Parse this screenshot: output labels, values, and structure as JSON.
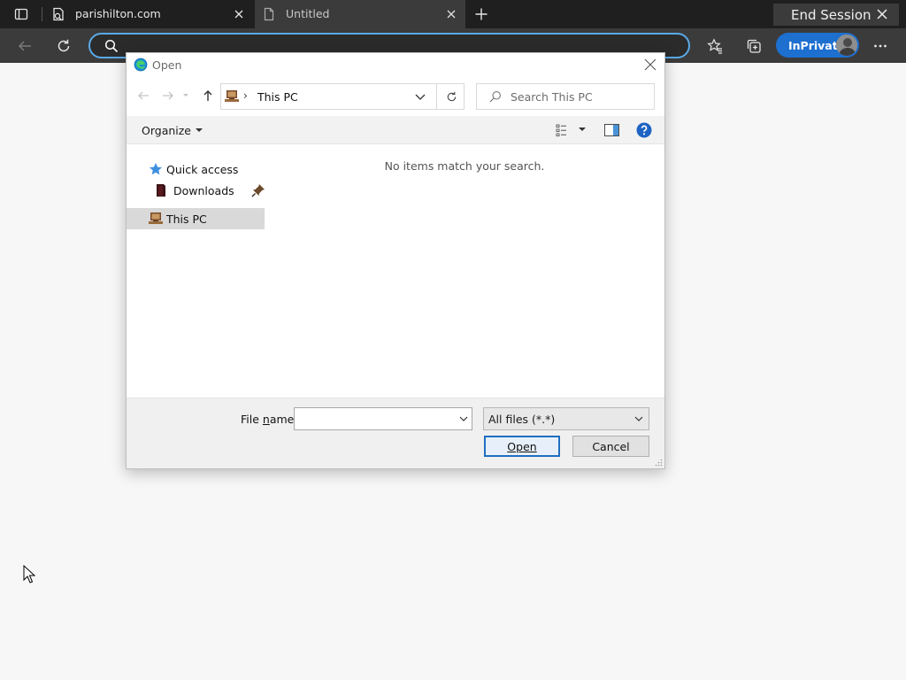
{
  "browser": {
    "tabs": [
      {
        "title": "parishilton.com",
        "active": true
      },
      {
        "title": "Untitled",
        "active": false
      }
    ],
    "end_session_label": "End Session",
    "address_value": "",
    "inprivate_label": "InPrivate"
  },
  "dialog": {
    "title": "Open",
    "path_separator": "›",
    "path_location": "This PC",
    "search_placeholder": "Search This PC",
    "organize_label": "Organize",
    "nav_items": [
      {
        "label": "Quick access"
      },
      {
        "label": "Downloads"
      },
      {
        "label": "This PC"
      }
    ],
    "empty_message": "No items match your search.",
    "file_name_label_prefix": "File ",
    "file_name_label_accel": "n",
    "file_name_label_suffix": "ame:",
    "file_name_value": "",
    "filter_selected": "All files (*.*)",
    "open_label": "Open",
    "cancel_label": "Cancel"
  },
  "colors": {
    "accent": "#1d6fd0",
    "address_focus": "#5aa9e6",
    "selected_nav": "#d9d9d9"
  }
}
